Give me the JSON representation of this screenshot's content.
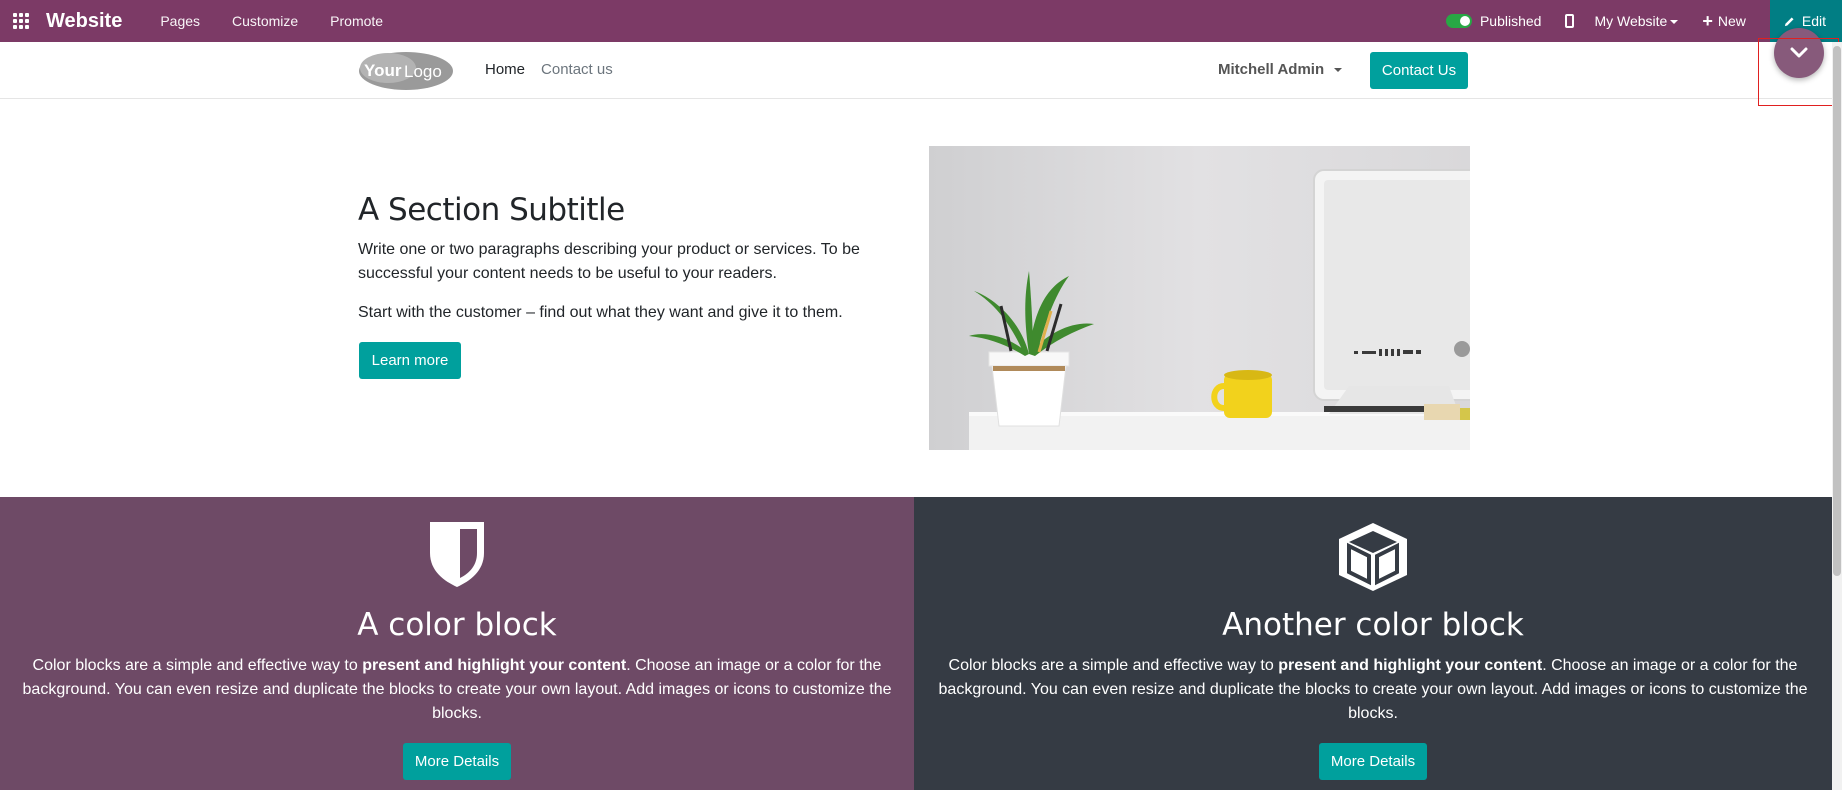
{
  "topbar": {
    "brand": "Website",
    "nav": [
      "Pages",
      "Customize",
      "Promote"
    ],
    "published_label": "Published",
    "published_on": true,
    "site_selector": "My Website",
    "new_label": "New",
    "edit_label": "Edit"
  },
  "header": {
    "logo_alt": "YourLogo",
    "nav": {
      "home": "Home",
      "contact": "Contact us"
    },
    "user": "Mitchell Admin",
    "cta": "Contact Us"
  },
  "hero": {
    "title": "A Section Subtitle",
    "p1": "Write one or two paragraphs describing your product or services. To be successful your content needs to be useful to your readers.",
    "p2": "Start with the customer – find out what they want and give it to them.",
    "button": "Learn more"
  },
  "blocks": [
    {
      "icon": "shield-icon",
      "title": "A color block",
      "text_before": "Color blocks are a simple and effective way to ",
      "text_bold": "present and highlight your content",
      "text_after": ". Choose an image or a color for the background. You can even resize and duplicate the blocks to create your own layout. Add images or icons to customize the blocks.",
      "button": "More Details"
    },
    {
      "icon": "cube-icon",
      "title": "Another color block",
      "text_before": "Color blocks are a simple and effective way to ",
      "text_bold": "present and highlight your content",
      "text_after": ". Choose an image or a color for the background. You can even resize and duplicate the blocks to create your own layout. Add images or icons to customize the blocks.",
      "button": "More Details"
    }
  ],
  "colors": {
    "topbar": "#7c3a66",
    "accent": "#00a09d",
    "block1": "#6e4a66",
    "block2": "#353b44"
  }
}
